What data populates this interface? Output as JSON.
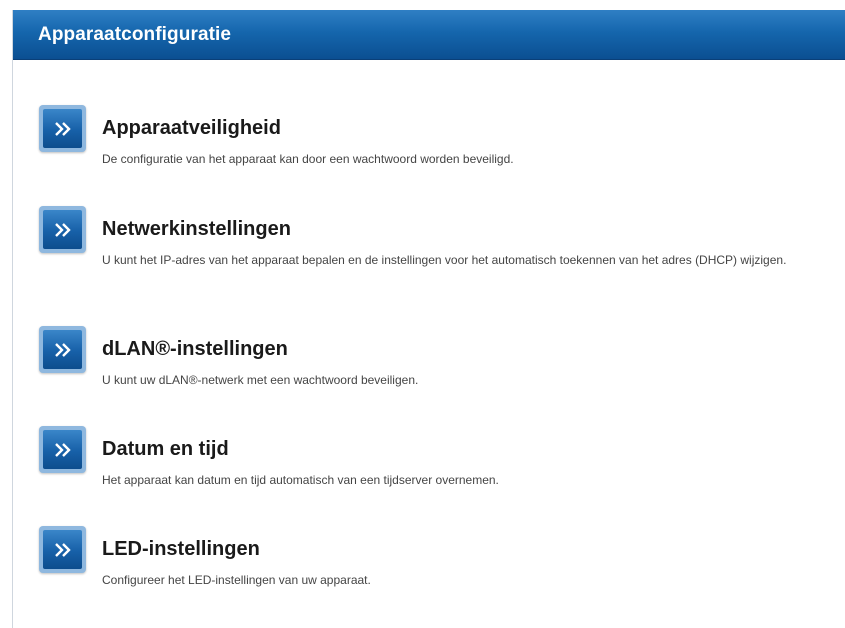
{
  "header": {
    "title": "Apparaatconfiguratie"
  },
  "colors": {
    "header_bg": "#1566ad",
    "button_bg": "#1760a8",
    "button_border": "#8fb8df"
  },
  "items": [
    {
      "icon": "double-chevron-right-icon",
      "title": "Apparaatveiligheid",
      "description": "De configuratie van het apparaat kan door een wachtwoord worden beveiligd."
    },
    {
      "icon": "double-chevron-right-icon",
      "title": "Netwerkinstellingen",
      "description": "U kunt het IP-adres van het apparaat bepalen en de instellingen voor het automatisch toekennen van het adres (DHCP) wijzigen."
    },
    {
      "icon": "double-chevron-right-icon",
      "title": "dLAN®-instellingen",
      "description": "U kunt uw dLAN®-netwerk met een wachtwoord beveiligen."
    },
    {
      "icon": "double-chevron-right-icon",
      "title": "Datum en tijd",
      "description": "Het apparaat kan datum en tijd automatisch van een tijdserver overnemen."
    },
    {
      "icon": "double-chevron-right-icon",
      "title": "LED-instellingen",
      "description": "Configureer het LED-instellingen van uw apparaat."
    }
  ]
}
